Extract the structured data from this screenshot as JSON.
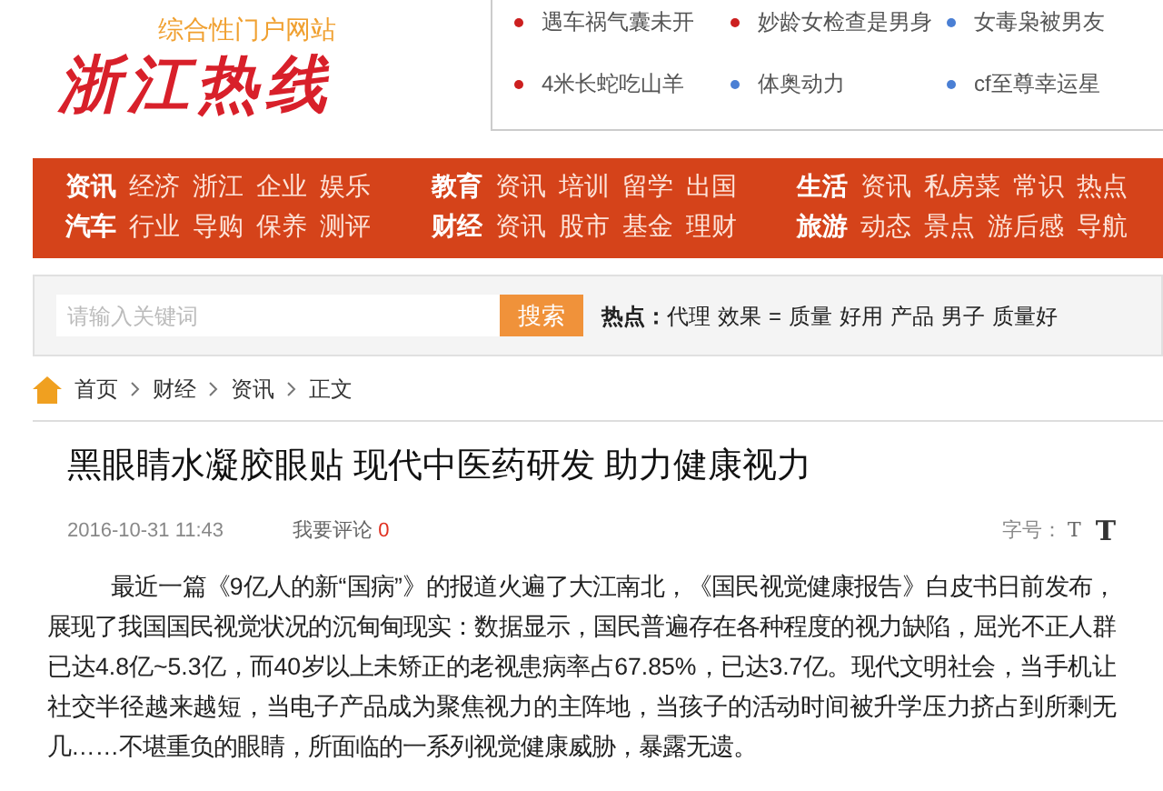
{
  "logo": {
    "name": "浙江热线",
    "tagline": "综合性门户网站"
  },
  "headlines": [
    {
      "text": "遇车祸气囊未开",
      "color": "#cc1f1f"
    },
    {
      "text": "妙龄女检查是男身",
      "color": "#cc1f1f"
    },
    {
      "text": "女毒枭被男友",
      "color": "#4a7fd4"
    },
    {
      "text": "4米长蛇吃山羊",
      "color": "#cc1f1f"
    },
    {
      "text": "体奥动力",
      "color": "#4a7fd4"
    },
    {
      "text": "cf至尊幸运星",
      "color": "#4a7fd4"
    }
  ],
  "nav": [
    {
      "rows": [
        {
          "title": "资讯",
          "links": [
            "经济",
            "浙江",
            "企业",
            "娱乐"
          ]
        },
        {
          "title": "汽车",
          "links": [
            "行业",
            "导购",
            "保养",
            "测评"
          ]
        }
      ]
    },
    {
      "rows": [
        {
          "title": "教育",
          "links": [
            "资讯",
            "培训",
            "留学",
            "出国"
          ]
        },
        {
          "title": "财经",
          "links": [
            "资讯",
            "股市",
            "基金",
            "理财"
          ]
        }
      ]
    },
    {
      "rows": [
        {
          "title": "生活",
          "links": [
            "资讯",
            "私房菜",
            "常识",
            "热点"
          ]
        },
        {
          "title": "旅游",
          "links": [
            "动态",
            "景点",
            "游后感",
            "导航"
          ]
        }
      ]
    }
  ],
  "search": {
    "placeholder": "请输入关键词",
    "button": "搜索",
    "hot_label": "热点：",
    "hot_words": [
      "代理",
      "效果",
      "=",
      "质量",
      "好用",
      "产品",
      "男子",
      "质量好"
    ]
  },
  "breadcrumb": [
    "首页",
    "财经",
    "资讯",
    "正文"
  ],
  "article": {
    "title": "黑眼睛水凝胶眼贴 现代中医药研发 助力健康视力",
    "date": "2016-10-31 11:43",
    "comment_label": "我要评论",
    "comment_count": "0",
    "font_label": "字号：",
    "font_small": "T",
    "font_large": "T",
    "body": "最近一篇《9亿人的新“国病”》的报道火遍了大江南北，《国民视觉健康报告》白皮书日前发布，展现了我国国民视觉状况的沉甸甸现实：数据显示，国民普遍存在各种程度的视力缺陷，屈光不正人群已达4.8亿~5.3亿，而40岁以上未矫正的老视患病率占67.85%，已达3.7亿。现代文明社会，当手机让社交半径越来越短，当电子产品成为聚焦视力的主阵地，当孩子的活动时间被升学压力挤占到所剩无几……不堪重负的眼睛，所面临的一系列视觉健康威胁，暴露无遗。"
  }
}
